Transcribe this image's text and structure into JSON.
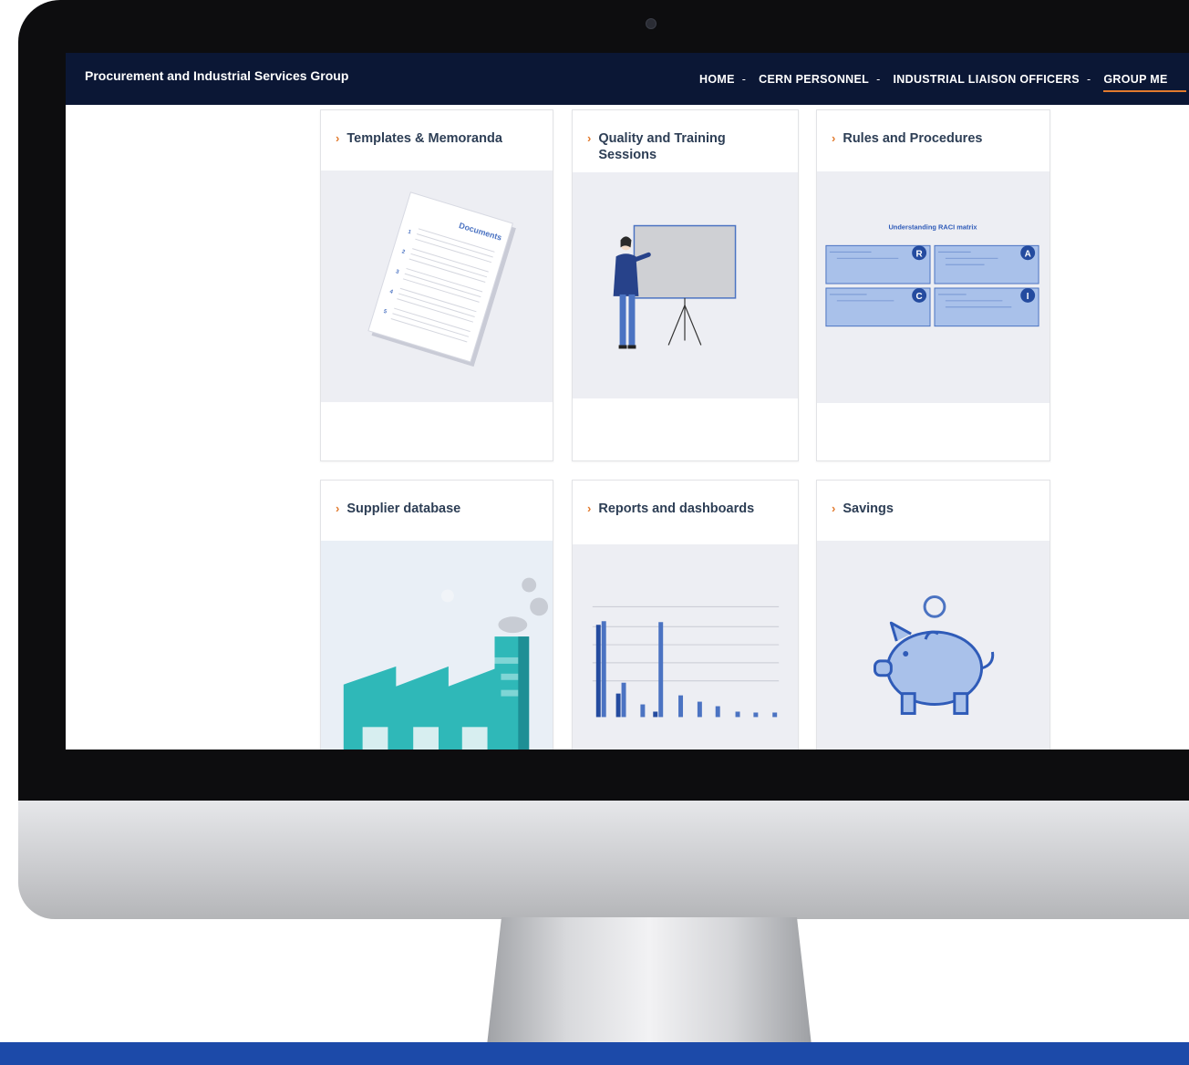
{
  "site": {
    "brand": "Procurement and Industrial Services Group"
  },
  "nav": {
    "items": [
      {
        "label": "HOME",
        "caret": "-"
      },
      {
        "label": "CERN PERSONNEL",
        "caret": "-"
      },
      {
        "label": "INDUSTRIAL LIAISON OFFICERS",
        "caret": "-"
      },
      {
        "label": "GROUP ME",
        "caret": ""
      }
    ]
  },
  "cards": [
    {
      "title": "Templates & Memoranda",
      "image": "documents-illustration"
    },
    {
      "title": "Quality and Training Sessions",
      "image": "training-presenter-illustration"
    },
    {
      "title": "Rules and Procedures",
      "image": "raci-matrix-illustration"
    },
    {
      "title": "Supplier database",
      "image": "factory-illustration"
    },
    {
      "title": "Reports and dashboards",
      "image": "bar-chart-illustration"
    },
    {
      "title": "Savings",
      "image": "piggy-bank-illustration"
    }
  ],
  "raci": {
    "title": "Understanding RACI matrix",
    "letters": [
      "R",
      "A",
      "C",
      "I"
    ]
  },
  "documents_label": "Documents",
  "document_numbers": [
    "1",
    "2",
    "3",
    "4",
    "5"
  ],
  "colors": {
    "navbar": "#0b1735",
    "accent": "#e27a2e",
    "illustration_blue": "#4b73c2",
    "teal": "#2fb8b8",
    "band": "#1c4aa9"
  }
}
